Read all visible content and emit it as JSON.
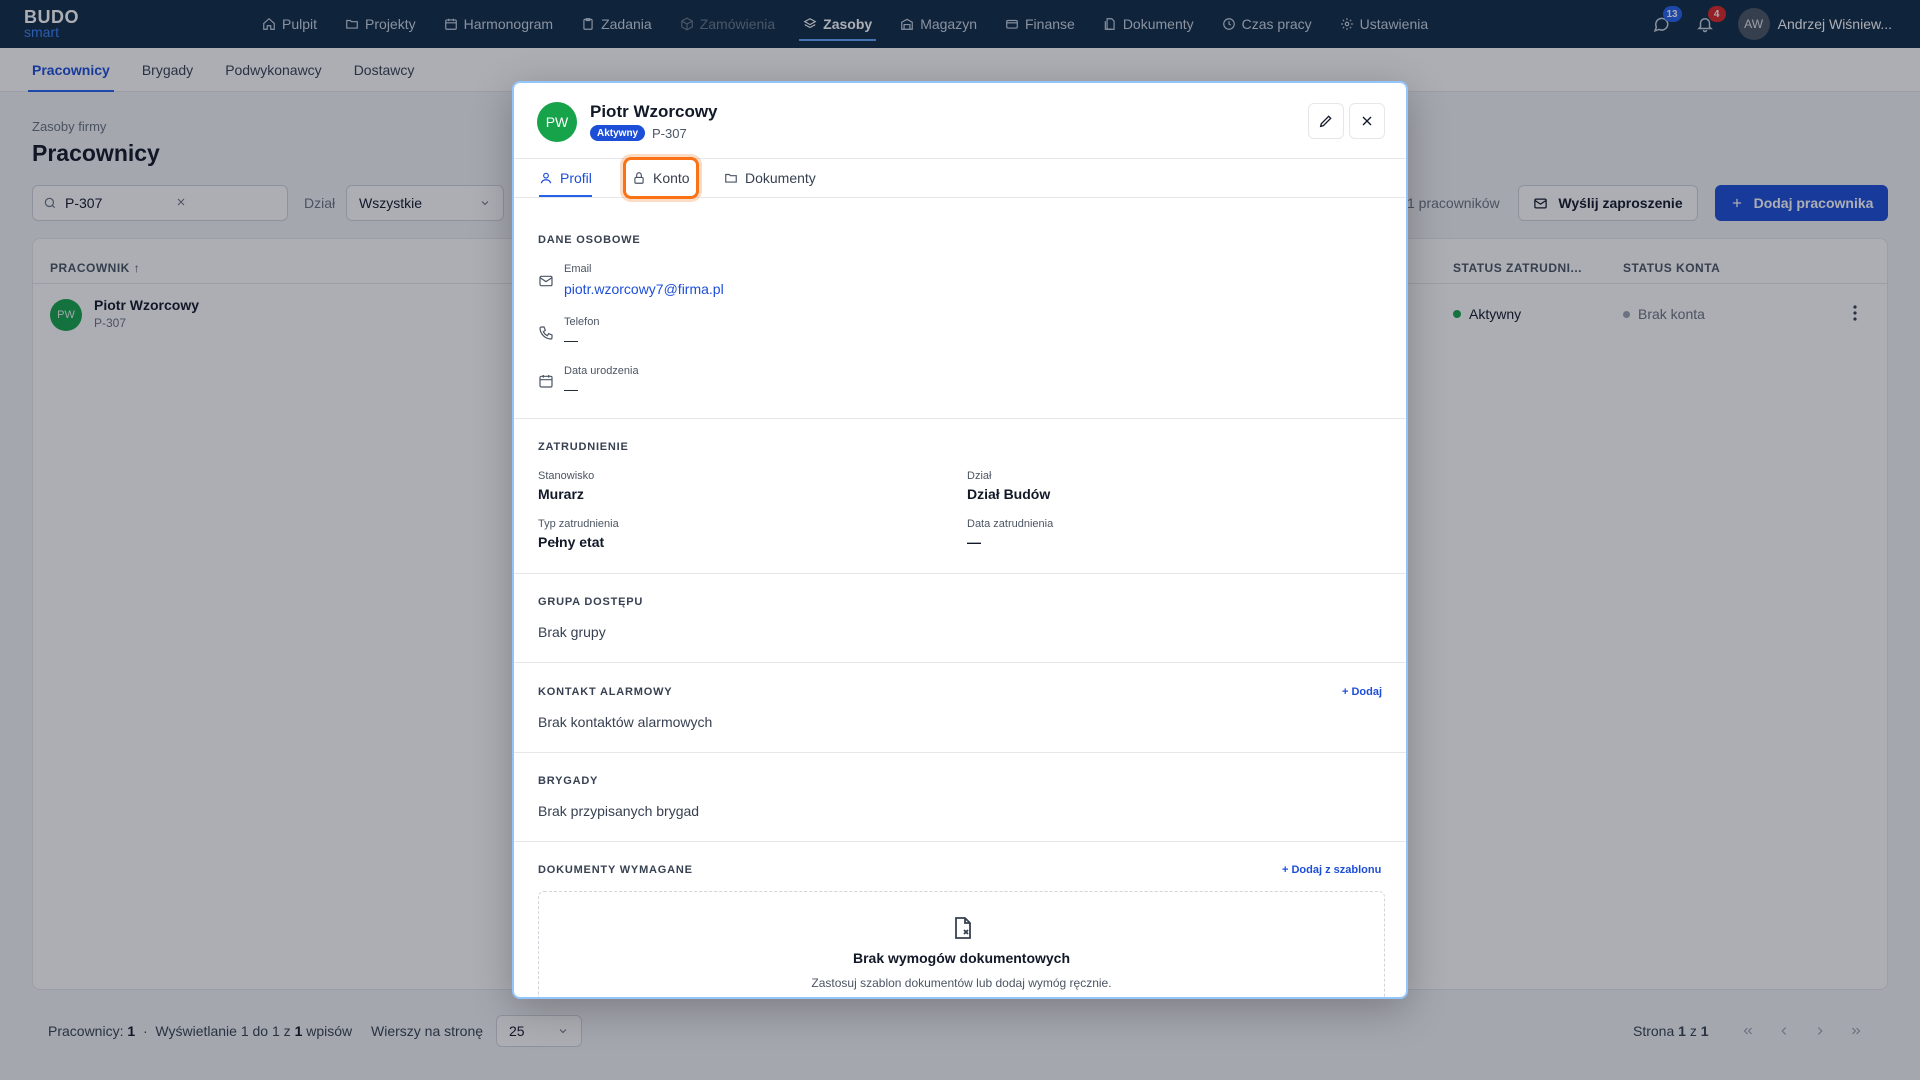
{
  "app": {
    "logo_line1": "BUDO",
    "logo_line2": "smart"
  },
  "nav": {
    "items": [
      {
        "label": "Pulpit",
        "icon": "home-icon"
      },
      {
        "label": "Projekty",
        "icon": "folder-icon"
      },
      {
        "label": "Harmonogram",
        "icon": "calendar-icon"
      },
      {
        "label": "Zadania",
        "icon": "clipboard-icon"
      },
      {
        "label": "Zamówienia",
        "icon": "box-icon"
      },
      {
        "label": "Zasoby",
        "icon": "layers-icon"
      },
      {
        "label": "Magazyn",
        "icon": "warehouse-icon"
      },
      {
        "label": "Finanse",
        "icon": "card-icon"
      },
      {
        "label": "Dokumenty",
        "icon": "documents-icon"
      },
      {
        "label": "Czas pracy",
        "icon": "clock-icon"
      },
      {
        "label": "Ustawienia",
        "icon": "gear-icon"
      }
    ],
    "active": "Zasoby",
    "messages_count": "13",
    "notifications_count": "4",
    "user_initials": "AW",
    "user_name": "Andrzej Wiśniew..."
  },
  "subtabs": [
    "Pracownicy",
    "Brygady",
    "Podwykonawcy",
    "Dostawcy"
  ],
  "page": {
    "breadcrumb": "Zasoby firmy",
    "title": "Pracownicy",
    "search_value": "P-307",
    "dept_label": "Dział",
    "dept_value": "Wszystkie",
    "count_text": "1 pracowników",
    "invite_button": "Wyślij zaproszenie",
    "add_button": "Dodaj pracownika"
  },
  "table": {
    "headers": {
      "employee": "PRACOWNIK ↑",
      "employment_status": "STATUS ZATRUDNI...",
      "account_status": "STATUS KONTA"
    },
    "rows": [
      {
        "initials": "PW",
        "name": "Piotr Wzorcowy",
        "id": "P-307",
        "status": "Aktywny",
        "account": "Brak konta"
      }
    ]
  },
  "footer": {
    "employees_label": "Pracownicy:",
    "employees_count": "1",
    "separator": "·",
    "showing_prefix": "Wyświetlanie 1 do 1 z",
    "showing_total": "1",
    "showing_suffix": "wpisów",
    "rows_label": "Wierszy na stronę",
    "rows_value": "25",
    "page_prefix": "Strona",
    "page_current": "1",
    "page_of": "z",
    "page_total": "1"
  },
  "modal": {
    "initials": "PW",
    "name": "Piotr Wzorcowy",
    "badge": "Aktywny",
    "id": "P-307",
    "tabs": [
      "Profil",
      "Konto",
      "Dokumenty"
    ],
    "active_tab": "Profil",
    "highlighted_tab": "Konto",
    "personal": {
      "title": "DANE OSOBOWE",
      "email_label": "Email",
      "email_value": "piotr.wzorcowy7@firma.pl",
      "phone_label": "Telefon",
      "phone_value": "—",
      "birth_label": "Data urodzenia",
      "birth_value": "—"
    },
    "employment": {
      "title": "ZATRUDNIENIE",
      "position_label": "Stanowisko",
      "position_value": "Murarz",
      "dept_label": "Dział",
      "dept_value": "Dział Budów",
      "type_label": "Typ zatrudnienia",
      "type_value": "Pełny etat",
      "date_label": "Data zatrudnienia",
      "date_value": "—"
    },
    "access": {
      "title": "GRUPA DOSTĘPU",
      "value": "Brak grupy"
    },
    "emergency": {
      "title": "KONTAKT ALARMOWY",
      "add": "+ Dodaj",
      "value": "Brak kontaktów alarmowych"
    },
    "crews": {
      "title": "BRYGADY",
      "value": "Brak przypisanych brygad"
    },
    "documents": {
      "title": "DOKUMENTY WYMAGANE",
      "add": "+ Dodaj z szablonu",
      "empty_title": "Brak wymogów dokumentowych",
      "empty_sub": "Zastosuj szablon dokumentów lub dodaj wymóg ręcznie."
    }
  },
  "colors": {
    "topbar": "#0f2a44",
    "accent": "#1d4ed8",
    "highlight": "#f97316",
    "avatar": "#16a34a"
  }
}
